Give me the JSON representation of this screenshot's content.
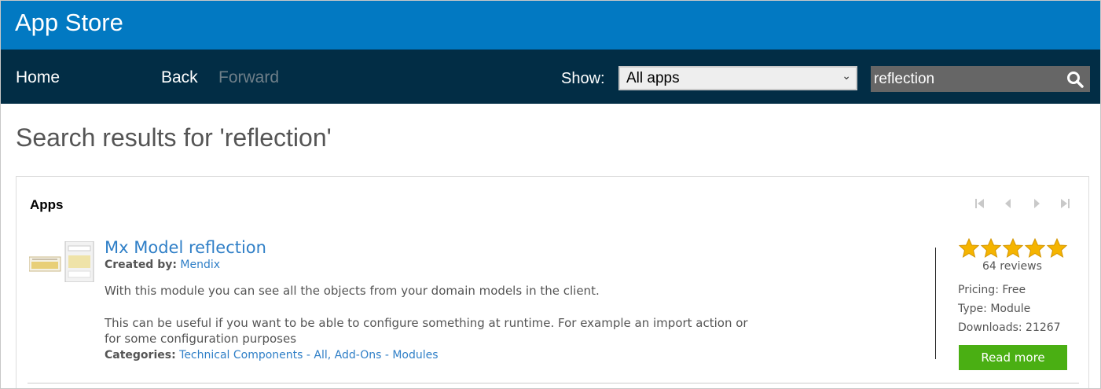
{
  "app": {
    "title": "App Store"
  },
  "nav": {
    "home": "Home",
    "back": "Back",
    "forward": "Forward",
    "show_label": "Show:",
    "filter_value": "All apps",
    "search_value": "reflection"
  },
  "page": {
    "title": "Search results for 'reflection'"
  },
  "section": {
    "title": "Apps"
  },
  "result": {
    "name": "Mx Model reflection",
    "created_by_label": "Created by:",
    "creator": "Mendix",
    "description_1": "With this module you can see all the objects from your domain models in the client.",
    "description_2a": "This can be useful if you want to be able to configure something at runtime. For example an import action or",
    "description_2b": "for some configuration purposes",
    "categories_label": "Categories:",
    "categories": "Technical Components - All, Add-Ons - Modules",
    "rating_stars": 5,
    "reviews": "64 reviews",
    "pricing": "Pricing:  Free",
    "type": "Type:  Module",
    "downloads": "Downloads:  21267",
    "read_more": "Read more"
  },
  "colors": {
    "title_bar": "#0279c2",
    "nav_bar": "#022d45",
    "link": "#2f7fc7",
    "read_more": "#4aaf13",
    "star": "#f5b400"
  },
  "icons": {
    "search": "search-icon",
    "pager_first": "first-page-icon",
    "pager_prev": "previous-page-icon",
    "pager_next": "next-page-icon",
    "pager_last": "last-page-icon",
    "star": "star-icon"
  }
}
